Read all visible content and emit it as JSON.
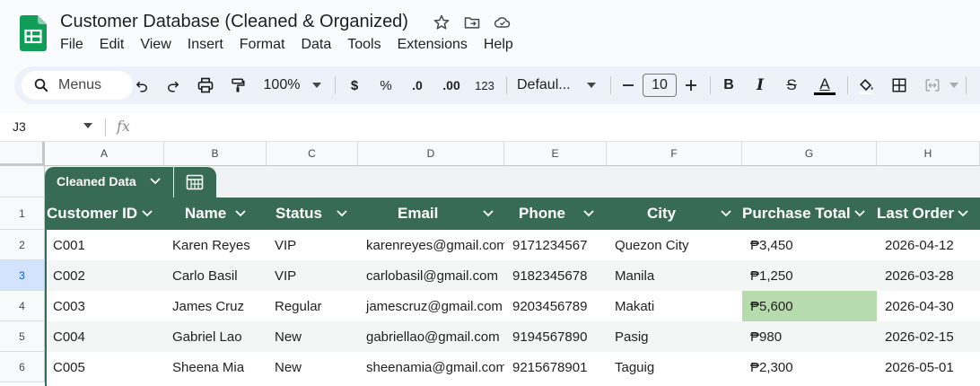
{
  "document": {
    "title": "Customer Database (Cleaned & Organized)",
    "menu": [
      "File",
      "Edit",
      "View",
      "Insert",
      "Format",
      "Data",
      "Tools",
      "Extensions",
      "Help"
    ]
  },
  "toolbar": {
    "menus_label": "Menus",
    "zoom": "100%",
    "currency": "$",
    "percent": "%",
    "decimal_decrease": ".0",
    "decimal_increase": ".00",
    "number_format": "123",
    "font": "Defaul...",
    "font_size": "10",
    "bold": "B",
    "italic": "I",
    "strike": "S",
    "text_color": "A"
  },
  "formula_bar": {
    "cell_ref": "J3",
    "fx": "fx"
  },
  "grid": {
    "columns": [
      "A",
      "B",
      "C",
      "D",
      "E",
      "F",
      "G",
      "H"
    ],
    "rows": [
      "1",
      "2",
      "3",
      "4",
      "5",
      "6"
    ],
    "selected_row": "3",
    "table_name": "Cleaned Data",
    "headers": [
      "Customer ID",
      "Name",
      "Status",
      "Email",
      "Phone",
      "City",
      "Purchase Total",
      "Last Order"
    ],
    "records": [
      [
        "C001",
        "Karen Reyes",
        "VIP",
        "karenreyes@gmail.com",
        "9171234567",
        "Quezon City",
        "₱3,450",
        "2026-04-12"
      ],
      [
        "C002",
        "Carlo Basil",
        "VIP",
        "carlobasil@gmail.com",
        "9182345678",
        "Manila",
        "₱1,250",
        "2026-03-28"
      ],
      [
        "C003",
        "James Cruz",
        "Regular",
        "jamescruz@gmail.com",
        "9203456789",
        "Makati",
        "₱5,600",
        "2026-04-30"
      ],
      [
        "C004",
        "Gabriel Lao",
        "New",
        "gabriellao@gmail.com",
        "9194567890",
        "Pasig",
        "₱980",
        "2026-02-15"
      ],
      [
        "C005",
        "Sheena Mia",
        "New",
        "sheenamia@gmail.com",
        "9215678901",
        "Taguig",
        "₱2,300",
        "2026-05-01"
      ]
    ],
    "highlight_color": "#b7dbad",
    "table_color": "#386b55"
  }
}
